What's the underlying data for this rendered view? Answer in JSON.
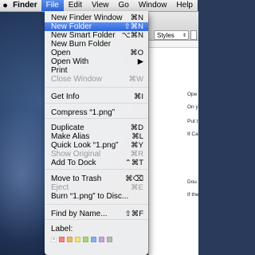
{
  "menubar": {
    "apple": "",
    "items": [
      "Finder",
      "File",
      "Edit",
      "View",
      "Go",
      "Window",
      "Help"
    ],
    "active_index": 1
  },
  "doc": {
    "styles_label": "Styles",
    "lines": [
      "Ope",
      "On y",
      "Put t",
      "If Ca",
      "Dou",
      "If the"
    ]
  },
  "file_menu": {
    "items": [
      {
        "label": "New Finder Window",
        "shortcut": "⌘N",
        "state": "normal"
      },
      {
        "label": "New Folder",
        "shortcut": "⇧⌘N",
        "state": "highlighted"
      },
      {
        "label": "New Smart Folder",
        "shortcut": "⌥⌘N",
        "state": "normal"
      },
      {
        "label": "New Burn Folder",
        "shortcut": "",
        "state": "normal"
      },
      {
        "label": "Open",
        "shortcut": "⌘O",
        "state": "normal"
      },
      {
        "label": "Open With",
        "shortcut": "▶",
        "state": "normal"
      },
      {
        "label": "Print",
        "shortcut": "",
        "state": "normal"
      },
      {
        "label": "Close Window",
        "shortcut": "⌘W",
        "state": "disabled"
      },
      {
        "label": "Get Info",
        "shortcut": "⌘I",
        "state": "normal"
      },
      {
        "label": "Compress “1.png”",
        "shortcut": "",
        "state": "normal"
      },
      {
        "label": "Duplicate",
        "shortcut": "⌘D",
        "state": "normal"
      },
      {
        "label": "Make Alias",
        "shortcut": "⌘L",
        "state": "normal"
      },
      {
        "label": "Quick Look “1.png”",
        "shortcut": "⌘Y",
        "state": "normal"
      },
      {
        "label": "Show Original",
        "shortcut": "⌘R",
        "state": "disabled"
      },
      {
        "label": "Add To Dock",
        "shortcut": "⌃⌘T",
        "state": "normal"
      },
      {
        "label": "Move to Trash",
        "shortcut": "⌘⌫",
        "state": "normal"
      },
      {
        "label": "Eject",
        "shortcut": "⌘E",
        "state": "disabled"
      },
      {
        "label": "Burn “1.png” to Disc...",
        "shortcut": "",
        "state": "normal"
      },
      {
        "label": "Find by Name...",
        "shortcut": "⇧⌘F",
        "state": "normal"
      }
    ],
    "label_title": "Label:",
    "label_colors": [
      "#ffffff",
      "#f2847e",
      "#f6b564",
      "#f2e76a",
      "#a9d77b",
      "#7fb3ef",
      "#c9a3e0",
      "#b9b9b9"
    ]
  }
}
